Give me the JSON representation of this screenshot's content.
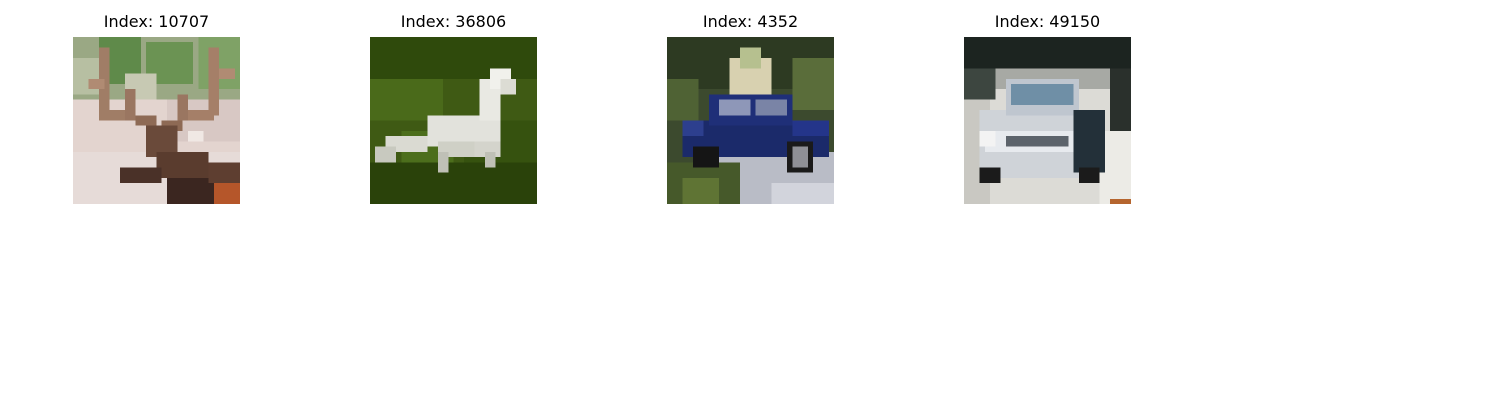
{
  "panels": [
    {
      "title": "Index: 10707",
      "subject": "deer"
    },
    {
      "title": "Index: 36806",
      "subject": "horse"
    },
    {
      "title": "Index: 4352",
      "subject": "automobile"
    },
    {
      "title": "Index: 49150",
      "subject": "automobile"
    }
  ]
}
